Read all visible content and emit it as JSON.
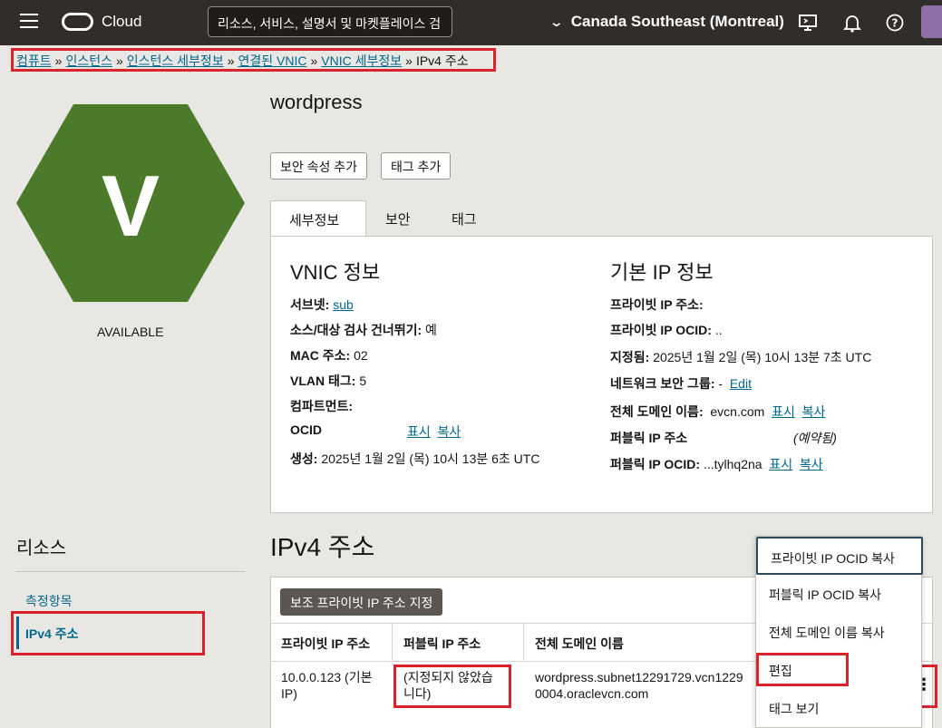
{
  "topbar": {
    "brand": "Cloud",
    "search_placeholder": "리소스, 서비스, 설명서 및 마켓플레이스 검",
    "region": "Canada Southeast (Montreal)"
  },
  "breadcrumb": [
    {
      "label": "컴퓨트"
    },
    {
      "label": "인스턴스"
    },
    {
      "label": "인스턴스 세부정보"
    },
    {
      "label": "연결된 VNIC"
    },
    {
      "label": "VNIC 세부정보"
    },
    {
      "label": "IPv4 주소"
    }
  ],
  "resource": {
    "icon_letter": "V",
    "status": "AVAILABLE",
    "name": "wordpress",
    "colors": {
      "hex_fill": "#4b7b2a"
    }
  },
  "actions": {
    "add_security_attr": "보안 속성 추가",
    "add_tag": "태그 추가"
  },
  "tabs": [
    "세부정보",
    "보안",
    "태그"
  ],
  "vnic_info": {
    "heading": "VNIC 정보",
    "subnet_label": "서브넷:",
    "subnet_value": "sub",
    "skip_check_label": "소스/대상 검사 건너뛰기:",
    "skip_check_value": "예",
    "mac_label": "MAC 주소:",
    "mac_value": "02",
    "vlan_label": "VLAN 태그:",
    "vlan_value": "5",
    "compartment_label": "컴파트먼트:",
    "ocid_label": "OCID",
    "show": "표시",
    "copy": "복사",
    "created_label": "생성:",
    "created_value": "2025년 1월 2일 (목) 10시 13분 6초 UTC"
  },
  "ip_info": {
    "heading": "기본 IP 정보",
    "private_ip_label": "프라이빗 IP 주소:",
    "private_ocid_label": "프라이빗 IP OCID:",
    "private_ocid_value": "..",
    "assigned_label": "지정됨:",
    "assigned_value": "2025년 1월 2일 (목) 10시 13분 7초 UTC",
    "nsg_label": "네트워크 보안 그룹:",
    "nsg_value": "-",
    "nsg_edit": "Edit",
    "fqdn_label": "전체 도메인 이름:",
    "fqdn_value": "evcn.com",
    "show": "표시",
    "copy": "복사",
    "public_ip_label": "퍼블릭 IP 주소",
    "public_ip_value": "(예약됨)",
    "public_ocid_label": "퍼블릭 IP OCID:",
    "public_ocid_value": "...tylhq2na"
  },
  "resources_nav": {
    "title": "리소스",
    "items": [
      "측정항목",
      "IPv4 주소"
    ]
  },
  "ipv4": {
    "title": "IPv4 주소",
    "assign_button": "보조 프라이빗 IP 주소 지정",
    "columns": [
      "프라이빗 IP 주소",
      "퍼블릭 IP 주소",
      "전체 도메인 이름"
    ],
    "rows": [
      {
        "private_ip": "10.0.0.123 (기본 IP)",
        "public_ip": "(지정되지 않았습니다)",
        "fqdn": "wordpress.subnet12291729.vcn12290004.oraclevcn.com"
      }
    ]
  },
  "row_menu": {
    "items": [
      "프라이빗 IP OCID 복사",
      "퍼블릭 IP OCID 복사",
      "전체 도메인 이름 복사",
      "편집",
      "태그 보기"
    ]
  }
}
